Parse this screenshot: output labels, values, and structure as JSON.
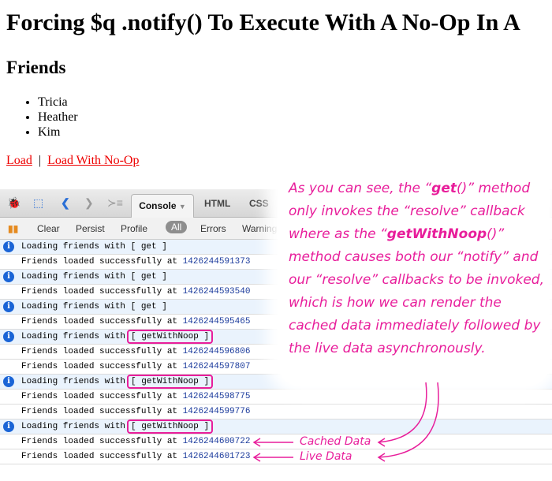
{
  "page": {
    "title": "Forcing $q .notify() To Execute With A No-Op In A",
    "heading": "Friends",
    "friends": [
      "Tricia",
      "Heather",
      "Kim"
    ],
    "links": {
      "load": "Load",
      "separator": "|",
      "load_noop": "Load With No-Op"
    }
  },
  "firebug": {
    "tabs": {
      "console": "Console",
      "html": "HTML",
      "css": "CSS"
    },
    "toolbar": {
      "clear": "Clear",
      "persist": "Persist",
      "profile": "Profile",
      "all": "All",
      "errors": "Errors",
      "warnings": "Warnings"
    },
    "rows": [
      {
        "type": "info",
        "text": "Loading friends with ",
        "arg": "[ get ]"
      },
      {
        "type": "log",
        "text": "Friends loaded successfully at ",
        "num": "1426244591373"
      },
      {
        "type": "info",
        "text": "Loading friends with ",
        "arg": "[ get ]"
      },
      {
        "type": "log",
        "text": "Friends loaded successfully at ",
        "num": "1426244593540"
      },
      {
        "type": "info",
        "text": "Loading friends with ",
        "arg": "[ get ]"
      },
      {
        "type": "log",
        "text": "Friends loaded successfully at ",
        "num": "1426244595465"
      },
      {
        "type": "info",
        "text": "Loading friends with",
        "arg": "[ getWithNoop ]",
        "boxed": true
      },
      {
        "type": "log",
        "text": "Friends loaded successfully at ",
        "num": "1426244596806"
      },
      {
        "type": "log",
        "text": "Friends loaded successfully at ",
        "num": "1426244597807"
      },
      {
        "type": "info",
        "text": "Loading friends with",
        "arg": "[ getWithNoop ]",
        "boxed": true
      },
      {
        "type": "log",
        "text": "Friends loaded successfully at ",
        "num": "1426244598775"
      },
      {
        "type": "log",
        "text": "Friends loaded successfully at ",
        "num": "1426244599776"
      },
      {
        "type": "info",
        "text": "Loading friends with",
        "arg": "[ getWithNoop ]",
        "boxed": true
      },
      {
        "type": "log",
        "text": "Friends loaded successfully at ",
        "num": "1426244600722"
      },
      {
        "type": "log",
        "text": "Friends loaded successfully at ",
        "num": "1426244601723"
      }
    ]
  },
  "annotation": {
    "p1": "As you can see, the “",
    "get": "get",
    "p2": "()” method only invokes the “resolve” callback where as the “",
    "gwn": "getWithNoop",
    "p3": "()” method causes both our “notify” and our “resolve” callbacks to be invoked, which is how we can render the cached data immediately followed by the live data asynchronously.",
    "cached": "Cached Data",
    "live": "Live Data"
  },
  "colors": {
    "accent": "#e81e9b",
    "info": "#1a64d6"
  }
}
